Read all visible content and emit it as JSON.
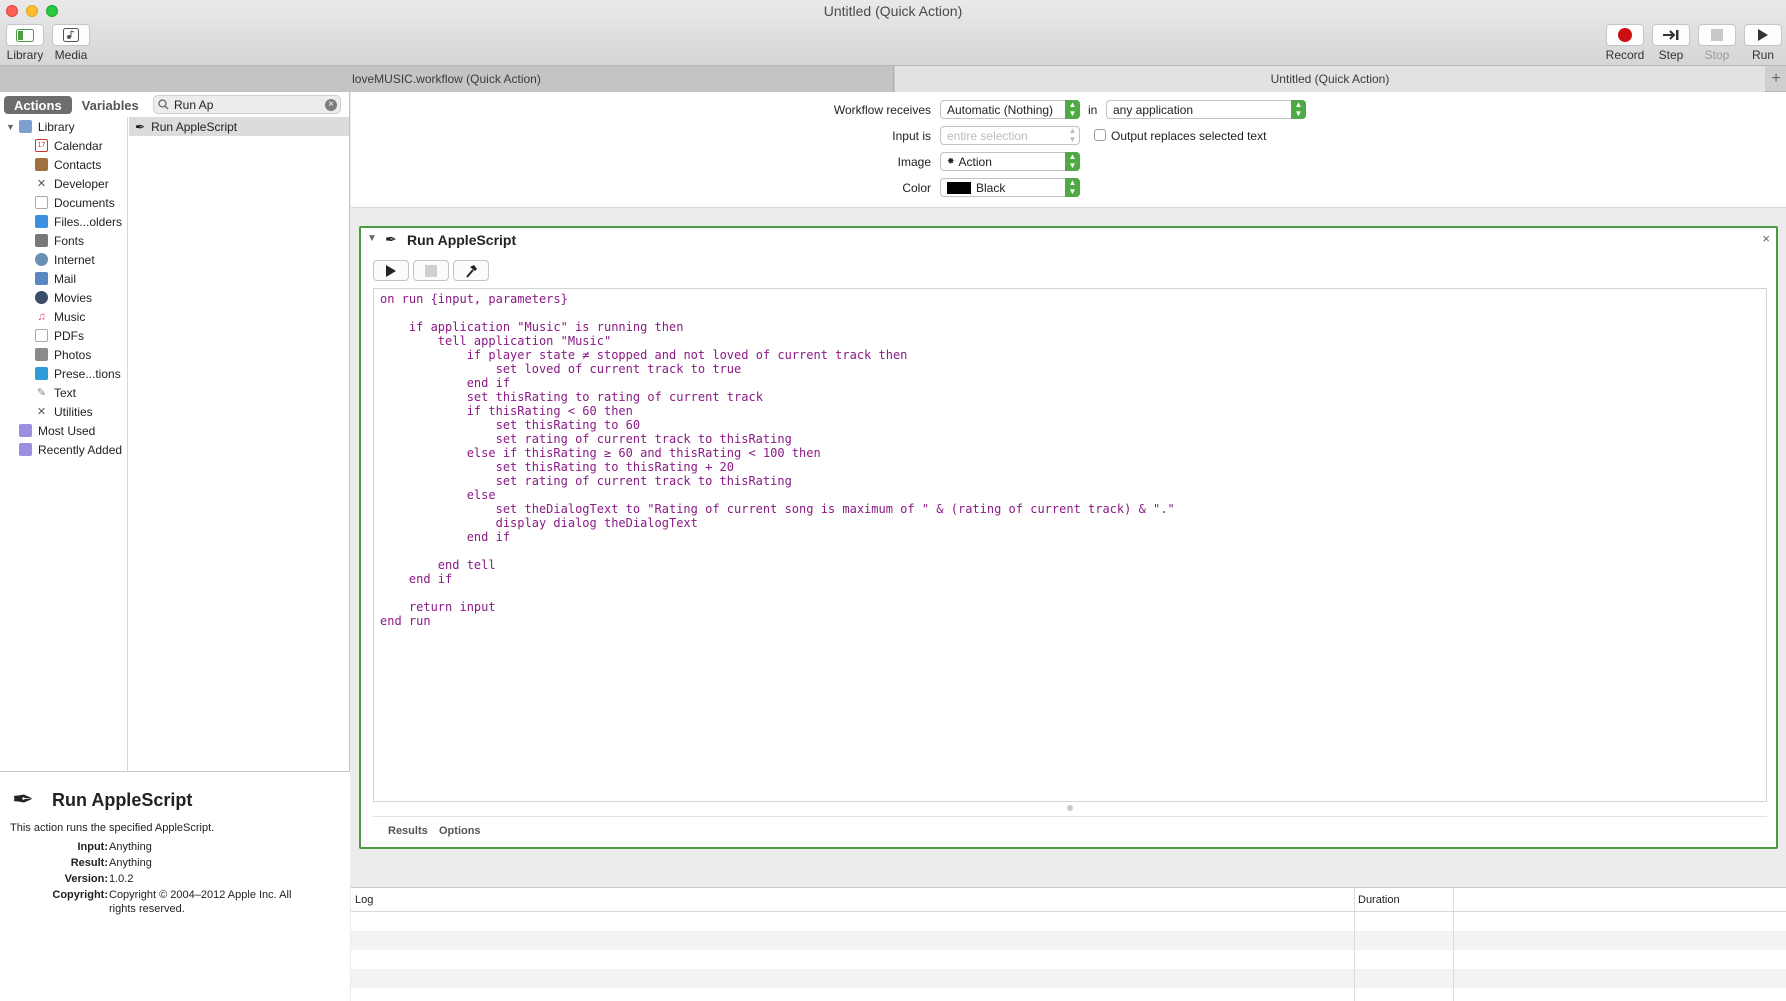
{
  "window": {
    "title": "Untitled (Quick Action)"
  },
  "toolbar": {
    "library_label": "Library",
    "media_label": "Media",
    "record_label": "Record",
    "step_label": "Step",
    "stop_label": "Stop",
    "run_label": "Run"
  },
  "tabs": [
    {
      "label": "loveMUSIC.workflow (Quick Action)"
    },
    {
      "label": "Untitled (Quick Action)"
    }
  ],
  "left": {
    "actions_label": "Actions",
    "variables_label": "Variables",
    "search_value": "Run Ap",
    "library_items": [
      {
        "label": "Library"
      },
      {
        "label": "Calendar"
      },
      {
        "label": "Contacts"
      },
      {
        "label": "Developer"
      },
      {
        "label": "Documents"
      },
      {
        "label": "Files...olders"
      },
      {
        "label": "Fonts"
      },
      {
        "label": "Internet"
      },
      {
        "label": "Mail"
      },
      {
        "label": "Movies"
      },
      {
        "label": "Music"
      },
      {
        "label": "PDFs"
      },
      {
        "label": "Photos"
      },
      {
        "label": "Prese...tions"
      },
      {
        "label": "Text"
      },
      {
        "label": "Utilities"
      },
      {
        "label": "Most Used"
      },
      {
        "label": "Recently Added"
      }
    ],
    "result_item": "Run AppleScript"
  },
  "description": {
    "title": "Run AppleScript",
    "text": "This action runs the specified AppleScript.",
    "input_k": "Input:",
    "input_v": "Anything",
    "result_k": "Result:",
    "result_v": "Anything",
    "version_k": "Version:",
    "version_v": "1.0.2",
    "copyright_k": "Copyright:",
    "copyright_v1": "Copyright © 2004–2012 Apple Inc.  All",
    "copyright_v2": "rights reserved."
  },
  "workflow": {
    "receives_label": "Workflow receives",
    "receives_value": "Automatic (Nothing)",
    "in_label": "in",
    "app_value": "any application",
    "input_is_label": "Input is",
    "input_is_value": "entire selection",
    "output_replaces_label": "Output replaces selected text",
    "image_label": "Image",
    "image_value": "Action",
    "color_label": "Color",
    "color_value": "Black"
  },
  "action": {
    "title": "Run AppleScript",
    "close": "×",
    "code": "on run {input, parameters}\n\t\n\tif application \"Music\" is running then\n\t\ttell application \"Music\"\n\t\t\tif player state ≠ stopped and not loved of current track then\n\t\t\t\tset loved of current track to true\n\t\t\tend if\n\t\t\tset thisRating to rating of current track\n\t\t\tif thisRating < 60 then\n\t\t\t\tset thisRating to 60\n\t\t\t\tset rating of current track to thisRating\n\t\t\telse if thisRating ≥ 60 and thisRating < 100 then\n\t\t\t\tset thisRating to thisRating + 20\n\t\t\t\tset rating of current track to thisRating\n\t\t\telse\n\t\t\t\tset theDialogText to \"Rating of current song is maximum of \" & (rating of current track) & \".\"\n\t\t\t\tdisplay dialog theDialogText\n\t\t\tend if\n\t\t\t\n\t\tend tell\n\tend if\n\t\n\treturn input\nend run",
    "results_label": "Results",
    "options_label": "Options"
  },
  "log": {
    "log_label": "Log",
    "duration_label": "Duration"
  },
  "colors": {
    "accent_green": "#4c9b43",
    "code_purple": "#8a1a86",
    "record_red": "#cc0f14"
  }
}
